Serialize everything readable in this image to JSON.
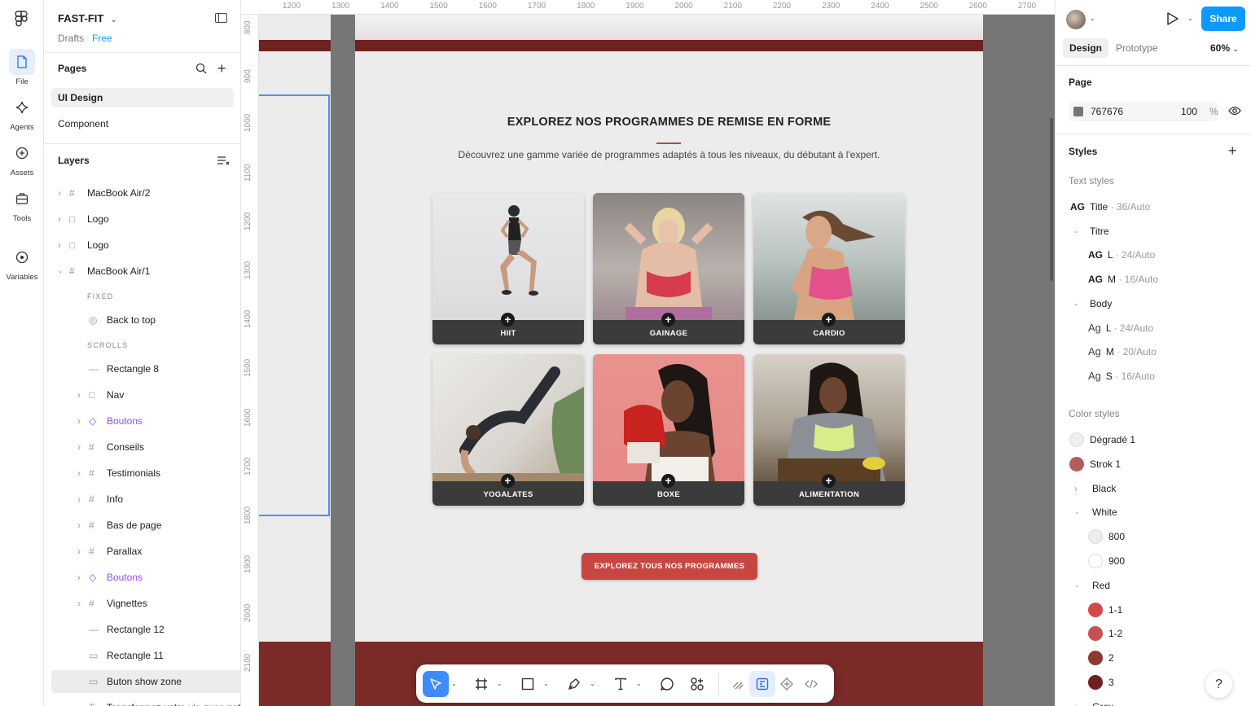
{
  "rail": {
    "items": [
      {
        "label": "File",
        "icon": "file-icon"
      },
      {
        "label": "Agents",
        "icon": "agents-icon"
      },
      {
        "label": "Assets",
        "icon": "assets-icon"
      },
      {
        "label": "Tools",
        "icon": "tools-icon"
      },
      {
        "label": "Variables",
        "icon": "variables-icon"
      }
    ]
  },
  "file": {
    "name": "FAST-FIT",
    "location": "Drafts",
    "plan": "Free"
  },
  "pages": {
    "title": "Pages",
    "items": [
      {
        "label": "UI Design",
        "selected": true
      },
      {
        "label": "Component",
        "selected": false
      }
    ]
  },
  "layers": {
    "title": "Layers",
    "items": [
      {
        "label": "MacBook Air/2",
        "type": "frame",
        "depth": 0,
        "caret": "right"
      },
      {
        "label": "Logo",
        "type": "group",
        "depth": 0,
        "caret": "right"
      },
      {
        "label": "Logo",
        "type": "group",
        "depth": 0,
        "caret": "right"
      },
      {
        "label": "MacBook Air/1",
        "type": "frame",
        "depth": 0,
        "caret": "down"
      },
      {
        "label": "FIXED",
        "type": "section-label"
      },
      {
        "label": "Back to top",
        "type": "instance",
        "depth": 1
      },
      {
        "label": "SCROLLS",
        "type": "section-label"
      },
      {
        "label": "Rectangle 8",
        "type": "line",
        "depth": 1
      },
      {
        "label": "Nav",
        "type": "group",
        "depth": 1,
        "caret": "right"
      },
      {
        "label": "Boutons",
        "type": "component",
        "depth": 1,
        "caret": "right"
      },
      {
        "label": "Conseils",
        "type": "frame",
        "depth": 1,
        "caret": "right"
      },
      {
        "label": "Testimonials",
        "type": "frame",
        "depth": 1,
        "caret": "right"
      },
      {
        "label": "Info",
        "type": "frame",
        "depth": 1,
        "caret": "right"
      },
      {
        "label": "Bas de page",
        "type": "frame",
        "depth": 1,
        "caret": "right"
      },
      {
        "label": "Parallax",
        "type": "frame",
        "depth": 1,
        "caret": "right"
      },
      {
        "label": "Boutons",
        "type": "component",
        "depth": 1,
        "caret": "right"
      },
      {
        "label": "Vignettes",
        "type": "frame",
        "depth": 1,
        "caret": "right"
      },
      {
        "label": "Rectangle 12",
        "type": "line",
        "depth": 1
      },
      {
        "label": "Rectangle 11",
        "type": "rect",
        "depth": 1
      },
      {
        "label": "Buton show zone",
        "type": "rect",
        "depth": 1,
        "selected": true
      },
      {
        "label": "Transformez votre vie avec notr",
        "type": "text",
        "depth": 1
      }
    ]
  },
  "canvas": {
    "background": "#767676",
    "ruler_top": [
      "1200",
      "1300",
      "1400",
      "1500",
      "1600",
      "1700",
      "1800",
      "1900",
      "2000",
      "2100",
      "2200",
      "2300",
      "2400",
      "2500",
      "2600",
      "2700"
    ],
    "ruler_left": [
      "800",
      "900",
      "1000",
      "1100",
      "1200",
      "1300",
      "1400",
      "1500",
      "1600",
      "1700",
      "1800",
      "1900",
      "2000",
      "2100"
    ],
    "section": {
      "title": "EXPLOREZ NOS PROGRAMMES DE REMISE EN FORME",
      "subtitle": "Découvrez une gamme variée de programmes adaptés à tous les niveaux, du débutant à l'expert.",
      "cards": [
        {
          "label": "HIIT"
        },
        {
          "label": "GAINAGE"
        },
        {
          "label": "CARDIO"
        },
        {
          "label": "YOGALATES"
        },
        {
          "label": "BOXE"
        },
        {
          "label": "ALIMENTATION"
        }
      ],
      "cta": "EXPLOREZ TOUS NOS PROGRAMMES"
    }
  },
  "toolbar": {
    "tools": [
      "move-icon",
      "frame-icon",
      "rectangle-icon",
      "pen-icon",
      "text-icon",
      "comment-icon",
      "actions-icon",
      "draw-icon",
      "design-mode-icon",
      "component-icon",
      "dev-mode-icon"
    ]
  },
  "right": {
    "share": "Share",
    "tabs": [
      {
        "label": "Design",
        "active": true
      },
      {
        "label": "Prototype",
        "active": false
      }
    ],
    "zoom": "60%",
    "page": {
      "title": "Page",
      "color": "767676",
      "opacity": "100",
      "unit": "%"
    },
    "styles_title": "Styles",
    "text_styles_title": "Text styles",
    "text_styles": [
      {
        "ag": "AG",
        "name": "Title",
        "meta": " · 36/Auto",
        "indent": 0
      },
      {
        "group": "Titre"
      },
      {
        "ag": "AG",
        "name": "L",
        "meta": " · 24/Auto",
        "indent": 1
      },
      {
        "ag": "AG",
        "name": "M",
        "meta": " · 16/Auto",
        "indent": 1
      },
      {
        "group": "Body"
      },
      {
        "ag": "Ag",
        "name": "L",
        "meta": " · 24/Auto",
        "indent": 1
      },
      {
        "ag": "Ag",
        "name": "M",
        "meta": " · 20/Auto",
        "indent": 1
      },
      {
        "ag": "Ag",
        "name": "S",
        "meta": " · 16/Auto",
        "indent": 1
      }
    ],
    "color_styles_title": "Color styles",
    "color_styles": [
      {
        "name": "Dégradé 1",
        "color": "#efefef",
        "indent": 0
      },
      {
        "name": "Strok 1",
        "color": "#b25c5c",
        "indent": 0
      },
      {
        "group": "Black",
        "open": false
      },
      {
        "group": "White",
        "open": true
      },
      {
        "name": "800",
        "color": "#ececec",
        "indent": 1
      },
      {
        "name": "900",
        "color": "#ffffff",
        "indent": 1
      },
      {
        "group": "Red",
        "open": true
      },
      {
        "name": "1-1",
        "color": "#d24a4a",
        "indent": 1
      },
      {
        "name": "1-2",
        "color": "#c85050",
        "indent": 1
      },
      {
        "name": "2",
        "color": "#8e3a32",
        "indent": 1
      },
      {
        "name": "3",
        "color": "#6e2020",
        "indent": 1
      },
      {
        "group": "Grey",
        "open": false
      }
    ],
    "help": "?"
  }
}
